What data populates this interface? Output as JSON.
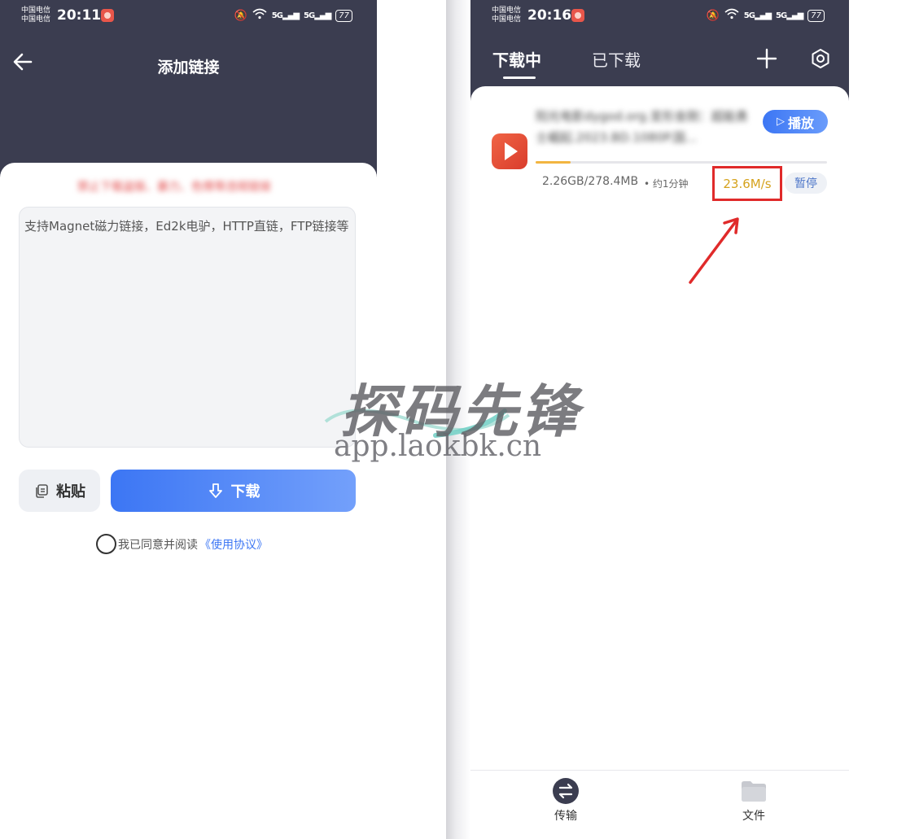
{
  "left_screen": {
    "status": {
      "carrier1": "中国电信",
      "carrier2": "中国电信",
      "time": "20:11",
      "signal1": "5G",
      "signal2": "5G",
      "battery": "77"
    },
    "title": "添加链接",
    "notice": "禁止下载盗版、暴力、色情等违规链接",
    "input_placeholder": "支持Magnet磁力链接，Ed2k电驴，HTTP直链，FTP链接等",
    "paste_label": "粘贴",
    "download_label": "下载",
    "agree_text": "我已同意并阅读",
    "agree_link": "《使用协议》"
  },
  "right_screen": {
    "status": {
      "carrier1": "中国电信",
      "carrier2": "中国电信",
      "time": "20:16",
      "signal1": "5G",
      "signal2": "5G",
      "battery": "77"
    },
    "tabs": {
      "downloading": "下载中",
      "downloaded": "已下载"
    },
    "task": {
      "title": "阳光电影dygod.org.变形金刚：超能勇士崛起.2023.BD.1080P.国...",
      "play_label": "播放",
      "progress": 0.12,
      "size": "2.26GB/278.4MB",
      "eta": "• 约1分钟",
      "speed": "23.6M/s",
      "pause_label": "暂停"
    },
    "nav": {
      "transfer": "传输",
      "files": "文件"
    }
  },
  "watermark": {
    "title": "探码先锋",
    "url": "app.laokbk.cn"
  },
  "colors": {
    "header": "#3b3d50",
    "accent": "#3c76f4",
    "speed": "#d5a21c",
    "highlight": "#e02a2a"
  }
}
